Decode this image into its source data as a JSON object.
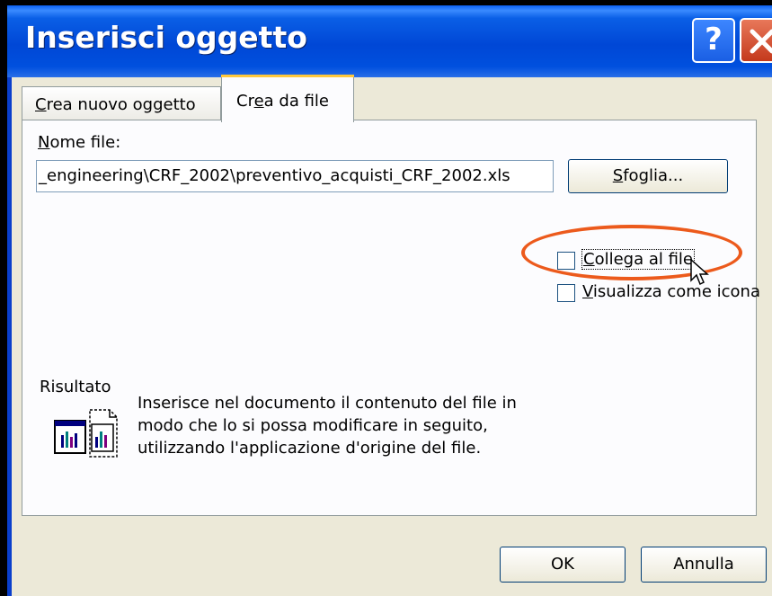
{
  "window": {
    "title": "Inserisci oggetto",
    "help_label": "?"
  },
  "tabs": [
    {
      "label_pre": "",
      "label_accel": "C",
      "label_post": "rea nuovo oggetto",
      "active": false
    },
    {
      "label_pre": "Cr",
      "label_accel": "e",
      "label_post": "a da file",
      "active": true
    }
  ],
  "form": {
    "filename_label_accel": "N",
    "filename_label_rest": "ome file:",
    "filename_value": "_engineering\\CRF_2002\\preventivo_acquisti_CRF_2002.xls",
    "browse_accel": "S",
    "browse_rest": "foglia..."
  },
  "options": {
    "link_accel": "C",
    "link_rest": "ollega al file",
    "link_checked": false,
    "icon_accel": "V",
    "icon_rest": "isualizza come icona",
    "icon_checked": false
  },
  "result": {
    "heading": "Risultato",
    "line1": "Inserisce nel documento il contenuto del file in",
    "line2": "modo che lo si possa modificare in seguito,",
    "line3": "utilizzando l'applicazione d'origine del file."
  },
  "buttons": {
    "ok": "OK",
    "cancel": "Annulla"
  },
  "colors": {
    "highlight_oval": "#ec5a1c",
    "titlebar": "#0047d6",
    "dialog_bg": "#ece9d8"
  }
}
